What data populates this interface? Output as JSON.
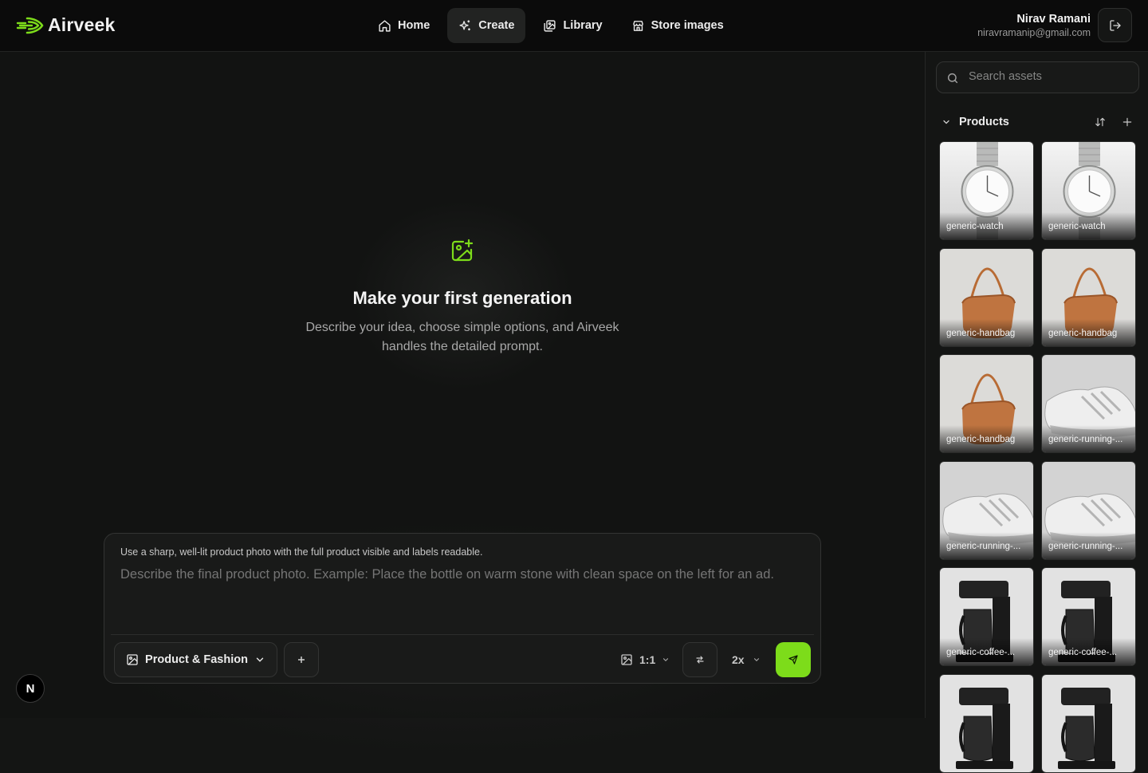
{
  "brand": {
    "name": "Airveek",
    "accent": "#7ddc1a"
  },
  "nav": [
    {
      "label": "Home",
      "icon": "home-icon",
      "active": false
    },
    {
      "label": "Create",
      "icon": "sparkles-icon",
      "active": true
    },
    {
      "label": "Library",
      "icon": "images-icon",
      "active": false
    },
    {
      "label": "Store images",
      "icon": "store-icon",
      "active": false
    }
  ],
  "user": {
    "name": "Nirav Ramani",
    "email": "niravramanip@gmail.com"
  },
  "empty_state": {
    "title": "Make your first generation",
    "subtitle": "Describe your idea, choose simple options, and Airveek handles the detailed prompt."
  },
  "composer": {
    "hint": "Use a sharp, well-lit product photo with the full product visible and labels readable.",
    "placeholder": "Describe the final product photo. Example: Place the bottle on warm stone with clean space on the left for an ad.",
    "category": "Product & Fashion",
    "aspect_ratio": "1:1",
    "scale": "2x"
  },
  "dev_badge": "N",
  "sidebar": {
    "search_placeholder": "Search assets",
    "section_title": "Products",
    "assets": [
      {
        "label": "generic-watch",
        "kind": "watch"
      },
      {
        "label": "generic-watch",
        "kind": "watch"
      },
      {
        "label": "generic-handbag",
        "kind": "handbag"
      },
      {
        "label": "generic-handbag",
        "kind": "handbag"
      },
      {
        "label": "generic-handbag",
        "kind": "handbag"
      },
      {
        "label": "generic-running-...",
        "kind": "shoe"
      },
      {
        "label": "generic-running-...",
        "kind": "shoe"
      },
      {
        "label": "generic-running-...",
        "kind": "shoe"
      },
      {
        "label": "generic-coffee-...",
        "kind": "coffee"
      },
      {
        "label": "generic-coffee-...",
        "kind": "coffee"
      },
      {
        "label": "",
        "kind": "coffee"
      },
      {
        "label": "",
        "kind": "coffee"
      }
    ]
  }
}
